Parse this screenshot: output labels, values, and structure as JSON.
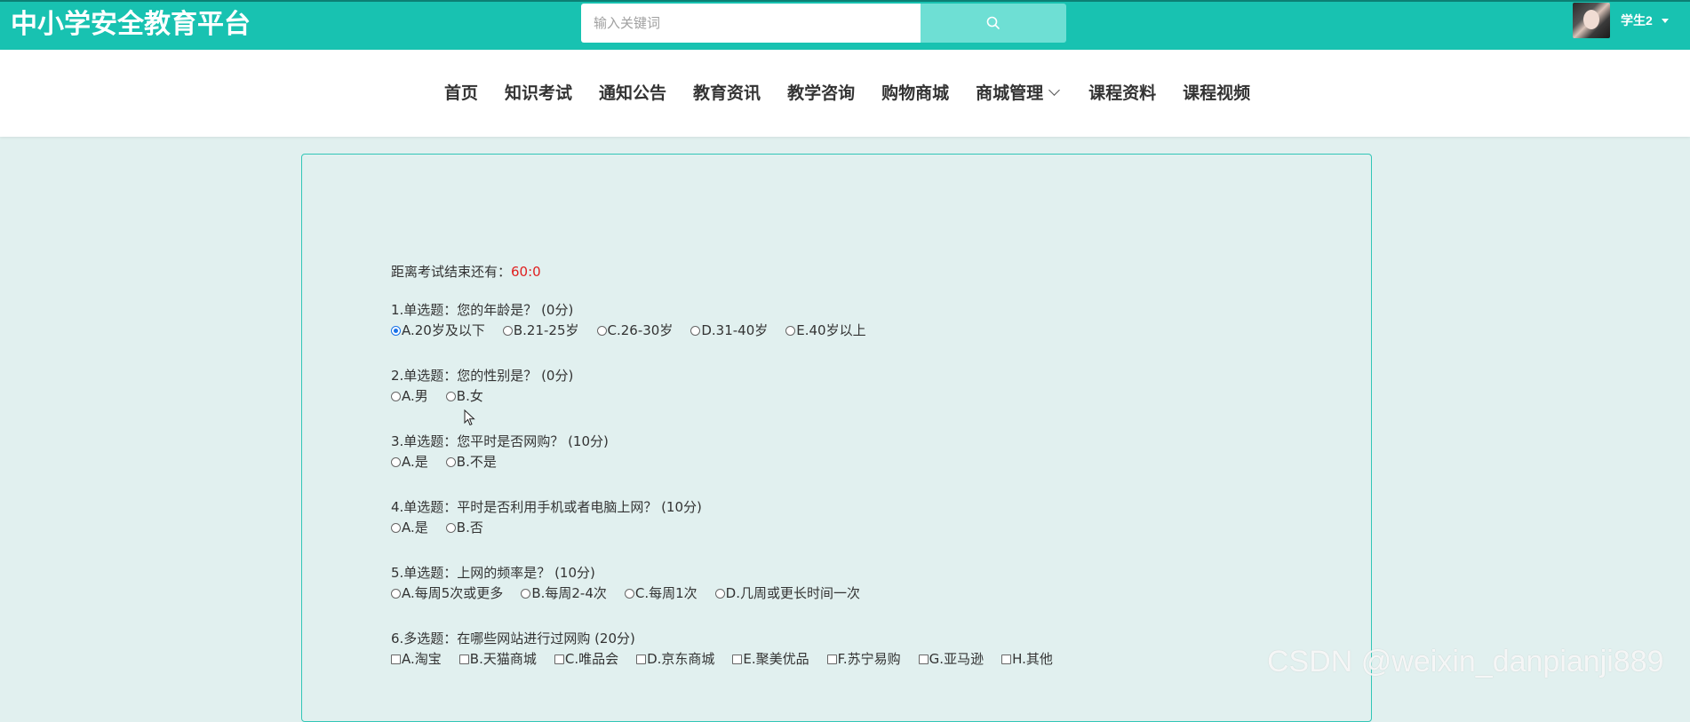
{
  "brand": {
    "title": "中小学安全教育平台"
  },
  "search": {
    "placeholder": "输入关键词",
    "icon": "search-icon"
  },
  "user": {
    "name": "学生2",
    "avatar": "avatar-photo"
  },
  "nav": {
    "items": [
      {
        "label": "首页"
      },
      {
        "label": "知识考试"
      },
      {
        "label": "通知公告"
      },
      {
        "label": "教育资讯"
      },
      {
        "label": "教学咨询"
      },
      {
        "label": "购物商城"
      },
      {
        "label": "商城管理",
        "dropdown": true
      },
      {
        "label": "课程资料"
      },
      {
        "label": "课程视频"
      }
    ]
  },
  "exam": {
    "countdown_label": "距离考试结束还有：",
    "countdown_value": "60:0",
    "questions": [
      {
        "title": "1.单选题：您的年龄是？ (0分)",
        "type": "radio",
        "options": [
          "A.20岁及以下",
          "B.21-25岁",
          "C.26-30岁",
          "D.31-40岁",
          "E.40岁以上"
        ],
        "selected": 0
      },
      {
        "title": "2.单选题：您的性别是？ (0分)",
        "type": "radio",
        "options": [
          "A.男",
          "B.女"
        ],
        "selected": null
      },
      {
        "title": "3.单选题：您平时是否网购？ (10分)",
        "type": "radio",
        "options": [
          "A.是",
          "B.不是"
        ],
        "selected": null
      },
      {
        "title": "4.单选题：平时是否利用手机或者电脑上网？ (10分)",
        "type": "radio",
        "options": [
          "A.是",
          "B.否"
        ],
        "selected": null
      },
      {
        "title": "5.单选题：上网的频率是？ (10分)",
        "type": "radio",
        "options": [
          "A.每周5次或更多",
          "B.每周2-4次",
          "C.每周1次",
          "D.几周或更长时间一次"
        ],
        "selected": null
      },
      {
        "title": "6.多选题：在哪些网站进行过网购 (20分)",
        "type": "checkbox",
        "options": [
          "A.淘宝",
          "B.天猫商城",
          "C.唯品会",
          "D.京东商城",
          "E.聚美优品",
          "F.苏宁易购",
          "G.亚马逊",
          "H.其他"
        ],
        "selected": []
      }
    ]
  },
  "watermark": {
    "text": "CSDN @weixin_danpianji889"
  },
  "colors": {
    "header_bg": "#18c2b1",
    "search_btn": "#6edfd4",
    "page_bg": "#e1f0ef",
    "panel_border": "#32c6b7",
    "countdown_color": "#e02020"
  }
}
